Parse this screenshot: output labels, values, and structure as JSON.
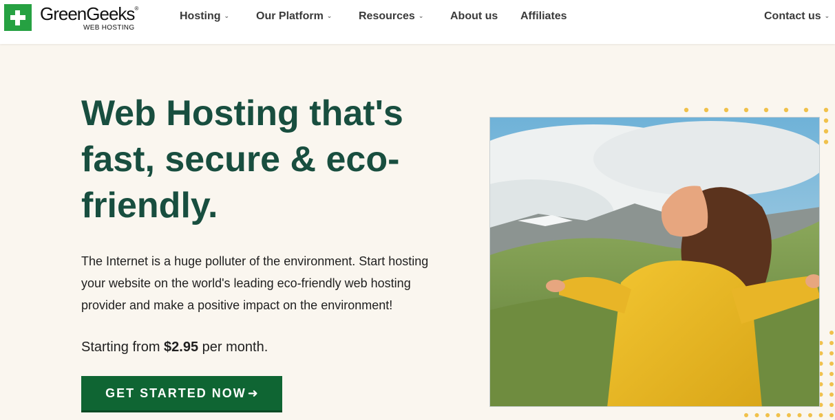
{
  "brand": {
    "name": "GreenGeeks",
    "registered": "®",
    "tagline": "WEB HOSTING",
    "colors": {
      "green": "#26a142",
      "dark_green": "#184e3f",
      "button": "#0f6533",
      "accent_dots": "#f0c14b"
    }
  },
  "nav": {
    "items": [
      {
        "label": "Hosting",
        "has_dropdown": true
      },
      {
        "label": "Our Platform",
        "has_dropdown": true
      },
      {
        "label": "Resources",
        "has_dropdown": true
      },
      {
        "label": "About us",
        "has_dropdown": false
      },
      {
        "label": "Affiliates",
        "has_dropdown": false
      }
    ],
    "contact": {
      "label": "Contact us",
      "has_dropdown": true
    }
  },
  "hero": {
    "headline": "Web Hosting that's fast, secure & eco-friendly.",
    "lead": "The Internet is a huge polluter of the environment. Start hosting your website on the world's leading eco-friendly web hosting provider and make a positive impact on the environment!",
    "price_prefix": "Starting from",
    "price_amount": "$2.95",
    "price_suffix": "per month.",
    "cta_label": "GET STARTED NOW",
    "cta_icon": "arrow-right-icon",
    "image_subject": "woman in yellow jacket with outstretched arms in green hills"
  },
  "icons": {
    "chevron": "chevron-down-icon",
    "logo_mark": "plus-icon"
  }
}
